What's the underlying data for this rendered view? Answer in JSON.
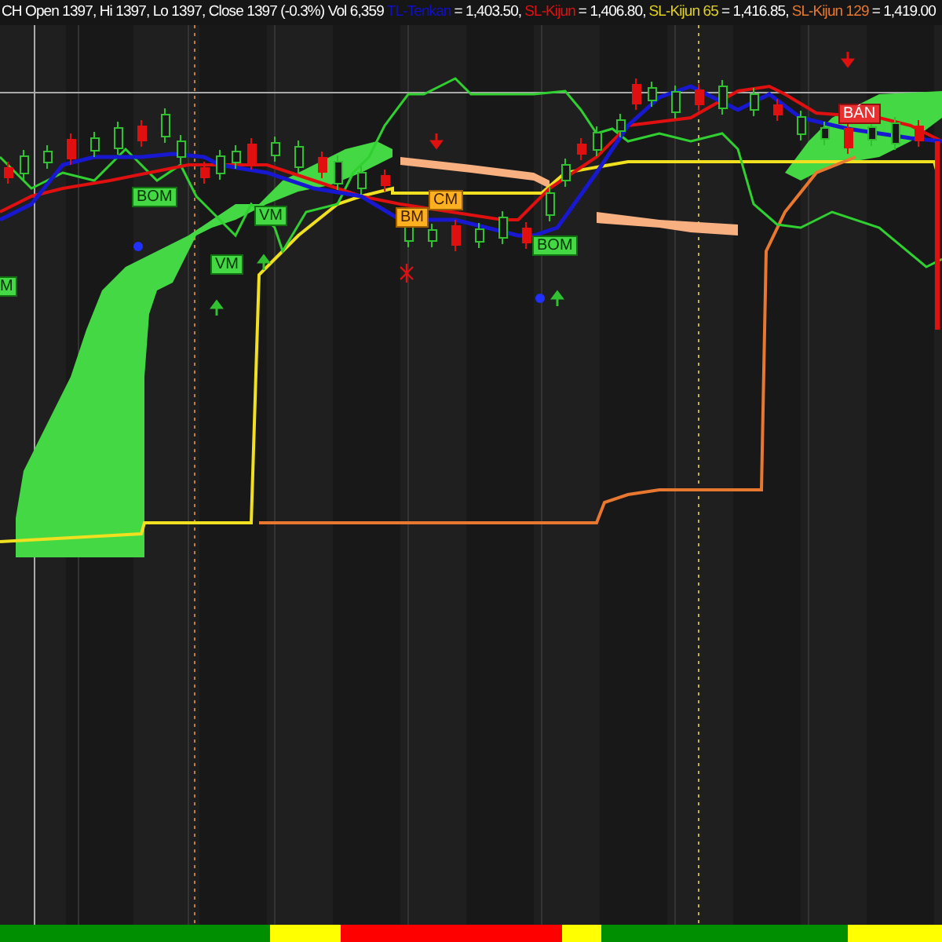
{
  "legend": {
    "quote": "CH Open 1397, Hi 1397, Lo 1397, Close 1397 (-0.3%) Vol 6,359",
    "indicators": [
      {
        "name": "TL-Tenkan",
        "value": "= 1,403.50,",
        "color": "#1010c8"
      },
      {
        "name": "SL-Kijun",
        "value": "= 1,406.80,",
        "color": "#e01010"
      },
      {
        "name": "SL-Kijun 65",
        "value": "= 1,416.85,",
        "color": "#e0d020"
      },
      {
        "name": "SL-Kijun 129",
        "value": "= 1,419.00",
        "color": "#e87830"
      }
    ]
  },
  "signals": [
    {
      "label": "BOM",
      "kind": "buy"
    },
    {
      "label": "VM",
      "kind": "buy"
    },
    {
      "label": "VM",
      "kind": "buy"
    },
    {
      "label": "M",
      "kind": "buy"
    },
    {
      "label": "BM",
      "kind": "caution"
    },
    {
      "label": "CM",
      "kind": "caution"
    },
    {
      "label": "BOM",
      "kind": "buy"
    },
    {
      "label": "BÁN",
      "kind": "sell"
    }
  ],
  "trend_bar": [
    {
      "color": "#008f00"
    },
    {
      "color": "#ffff00"
    },
    {
      "color": "#ff0000"
    },
    {
      "color": "#ffff00"
    },
    {
      "color": "#008f00"
    },
    {
      "color": "#ffff00"
    }
  ]
}
